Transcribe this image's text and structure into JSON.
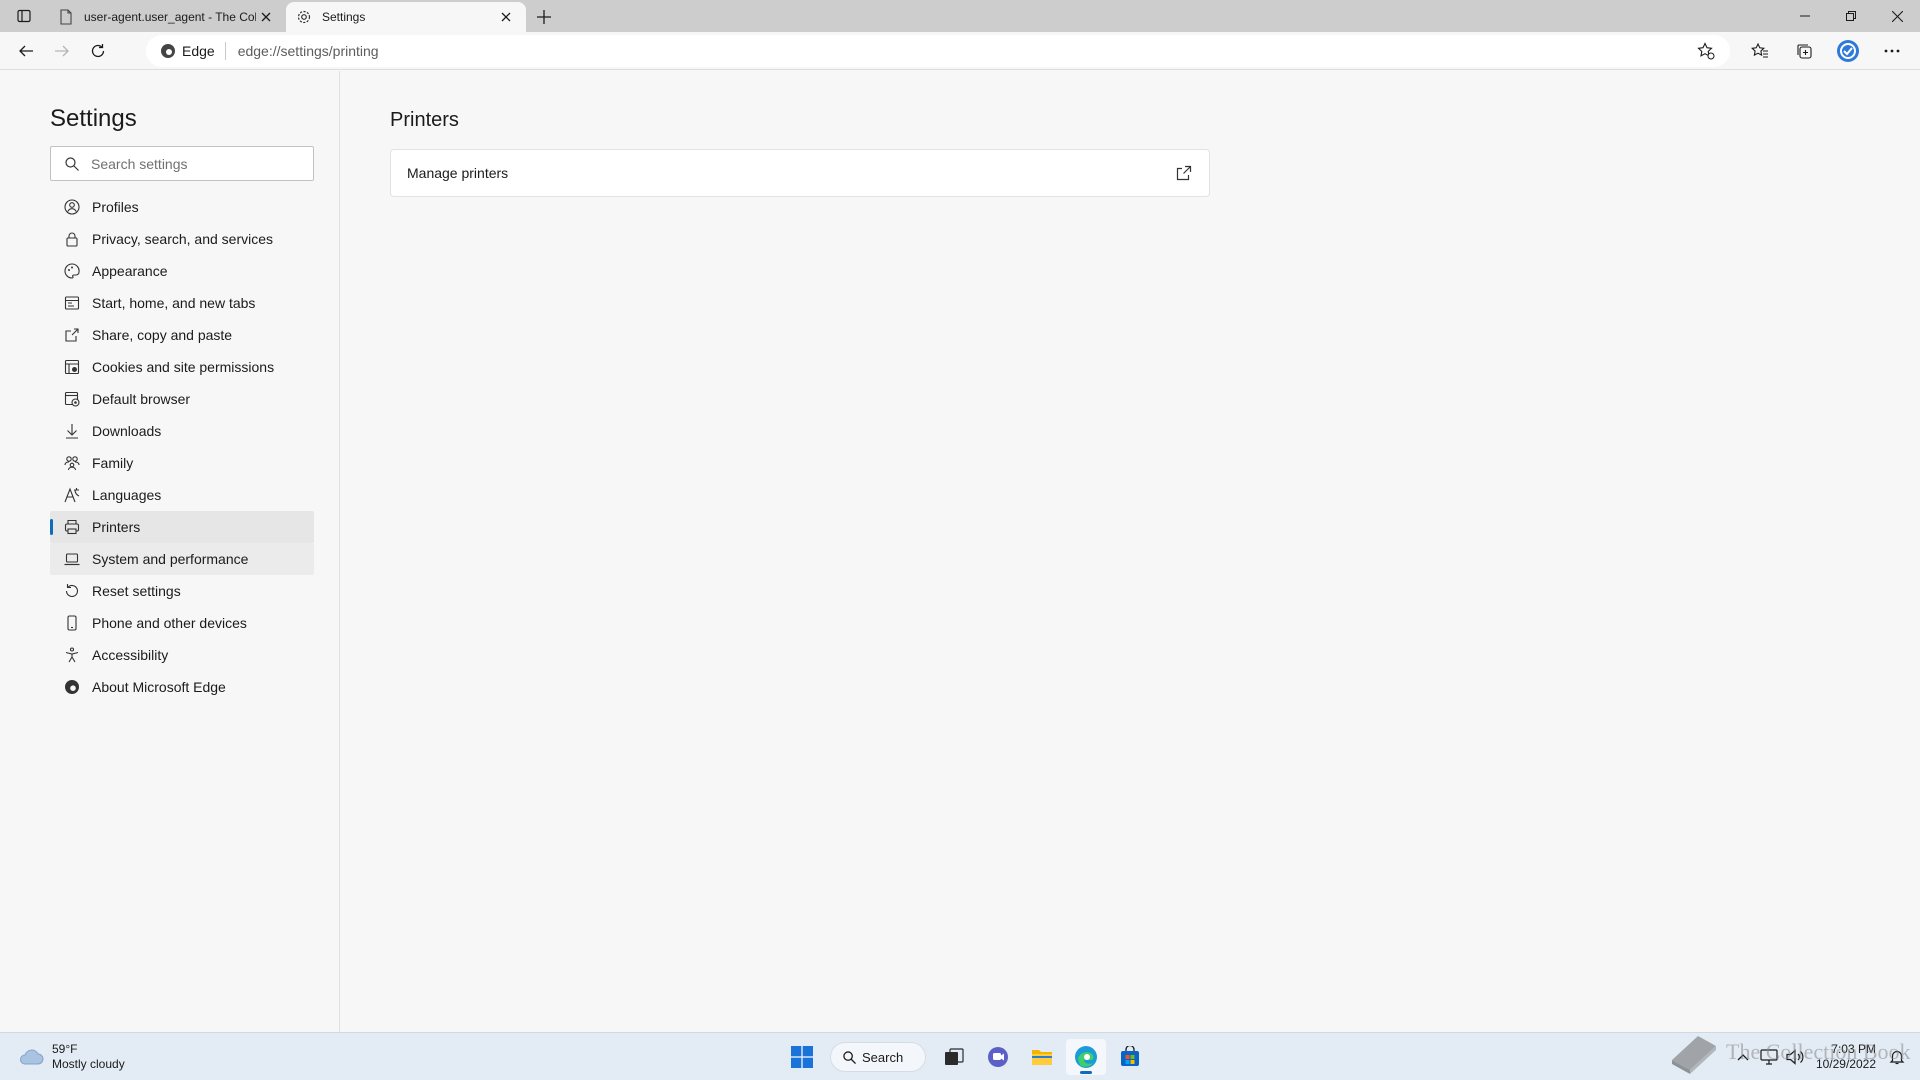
{
  "browser": {
    "tabs": [
      {
        "title": "user-agent.user_agent - The Coll",
        "active": false
      },
      {
        "title": "Settings",
        "active": true
      }
    ],
    "address": {
      "site_label": "Edge",
      "url": "edge://settings/printing"
    }
  },
  "sidebar": {
    "title": "Settings",
    "search_placeholder": "Search settings",
    "items": [
      {
        "label": "Profiles",
        "icon": "profile-icon"
      },
      {
        "label": "Privacy, search, and services",
        "icon": "lock-icon"
      },
      {
        "label": "Appearance",
        "icon": "appearance-icon"
      },
      {
        "label": "Start, home, and new tabs",
        "icon": "home-tabs-icon"
      },
      {
        "label": "Share, copy and paste",
        "icon": "share-icon"
      },
      {
        "label": "Cookies and site permissions",
        "icon": "cookies-icon"
      },
      {
        "label": "Default browser",
        "icon": "default-browser-icon"
      },
      {
        "label": "Downloads",
        "icon": "download-icon"
      },
      {
        "label": "Family",
        "icon": "family-icon"
      },
      {
        "label": "Languages",
        "icon": "languages-icon"
      },
      {
        "label": "Printers",
        "icon": "printer-icon",
        "selected": true
      },
      {
        "label": "System and performance",
        "icon": "laptop-icon",
        "hover": true
      },
      {
        "label": "Reset settings",
        "icon": "reset-icon"
      },
      {
        "label": "Phone and other devices",
        "icon": "phone-icon"
      },
      {
        "label": "Accessibility",
        "icon": "accessibility-icon"
      },
      {
        "label": "About Microsoft Edge",
        "icon": "edge-icon"
      }
    ]
  },
  "main": {
    "title": "Printers",
    "card_label": "Manage printers"
  },
  "taskbar": {
    "weather_temp": "59°F",
    "weather_desc": "Mostly cloudy",
    "search_label": "Search",
    "time": "7:03 PM",
    "date": "10/29/2022",
    "watermark": "The Collection Book"
  },
  "colors": {
    "accent": "#0f6cbd",
    "selected_bg": "#e6e6e6"
  }
}
